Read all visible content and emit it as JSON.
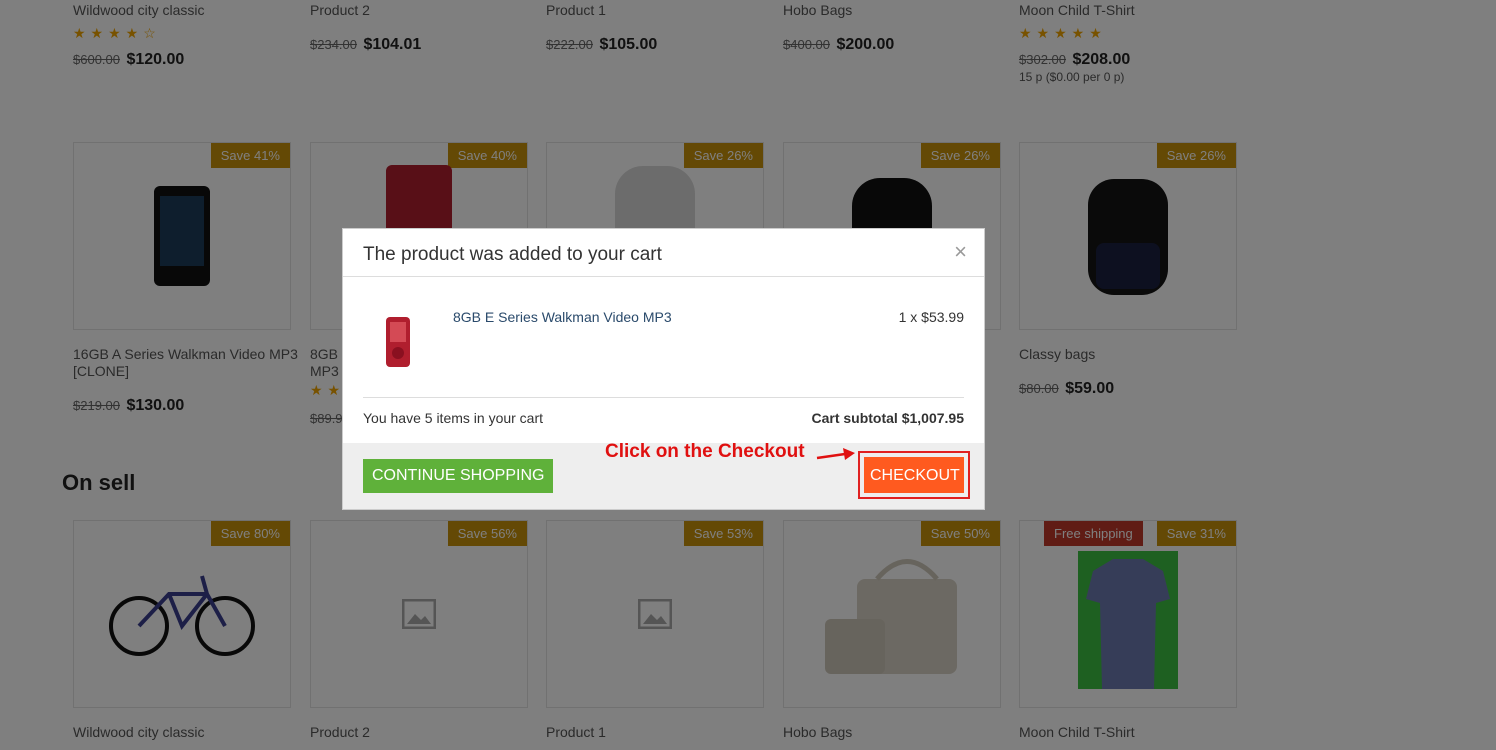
{
  "top_row": [
    {
      "name": "Wildwood city classic",
      "rating": 4,
      "old": "$600.00",
      "new": "$120.00"
    },
    {
      "name": "Product 2",
      "old": "$234.00",
      "new": "$104.01"
    },
    {
      "name": "Product 1",
      "old": "$222.00",
      "new": "$105.00"
    },
    {
      "name": "Hobo Bags",
      "old": "$400.00",
      "new": "$200.00"
    },
    {
      "name": "Moon Child T-Shirt",
      "rating": 5,
      "old": "$302.00",
      "new": "$208.00",
      "unit": "15 p ($0.00 per 0 p)"
    }
  ],
  "mid_row": [
    {
      "save": "Save 41%",
      "name": "16GB A Series Walkman Video MP3 [CLONE]",
      "old": "$219.00",
      "new": "$130.00"
    },
    {
      "save": "Save 40%",
      "name": "8GB",
      "name2": "MP3",
      "old": "$89.9"
    },
    {
      "save": "Save 26%"
    },
    {
      "save": "Save 26%"
    },
    {
      "save": "Save 26%",
      "name": "Classy bags",
      "old": "$80.00",
      "new": "$59.00"
    }
  ],
  "section": {
    "title": "On sell"
  },
  "bottom_row": [
    {
      "save": "Save 80%",
      "name": "Wildwood city classic"
    },
    {
      "save": "Save 56%",
      "name": "Product 2"
    },
    {
      "save": "Save 53%",
      "name": "Product 1"
    },
    {
      "save": "Save 50%",
      "name": "Hobo Bags"
    },
    {
      "free": "Free shipping",
      "save": "Save 31%",
      "name": "Moon Child T-Shirt"
    }
  ],
  "modal": {
    "title": "The product was added to your cart",
    "close": "×",
    "product_name": "8GB E Series Walkman Video MP3",
    "qty_price": "1 x $53.99",
    "items_text": "You have 5 items in your cart",
    "subtotal": "Cart subtotal $1,007.95",
    "continue_label": "CONTINUE SHOPPING",
    "checkout_label": "CHECKOUT"
  },
  "annotation": "Click on the Checkout",
  "colors": {
    "accent": "#ff5a1f",
    "continue": "#5fb13a",
    "save_badge": "#c9920a",
    "annotation": "#e01010"
  }
}
